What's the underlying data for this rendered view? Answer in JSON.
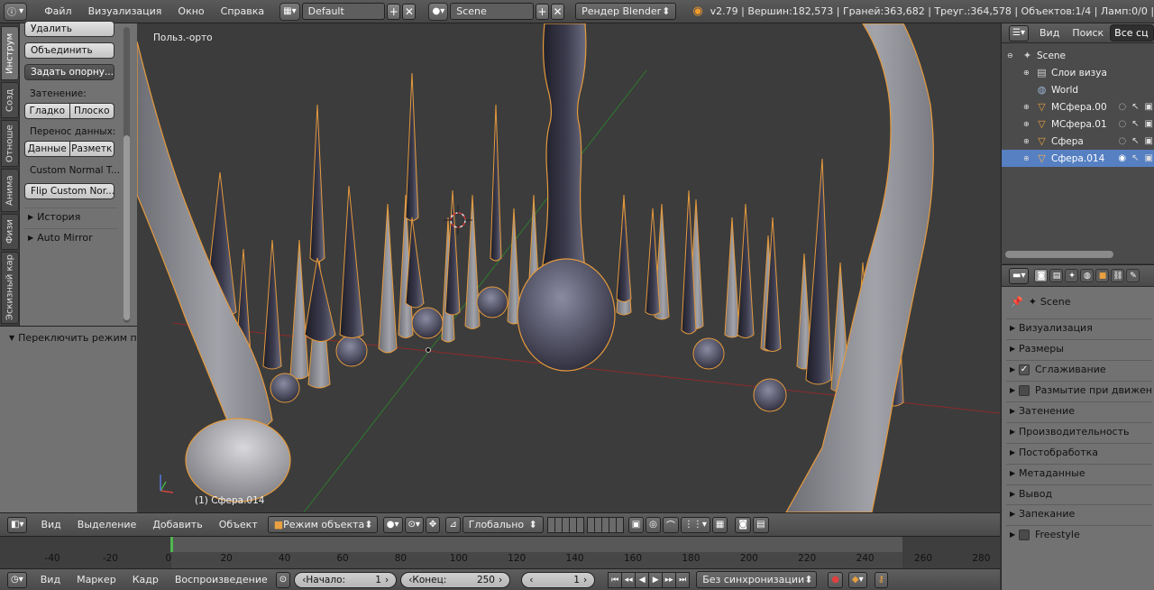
{
  "topbar": {
    "menus": [
      "Файл",
      "Визуализация",
      "Окно",
      "Справка"
    ],
    "layout": "Default",
    "scene": "Scene",
    "engine": "Рендер Blender",
    "stats": "v2.79 | Вершин:182,573 | Граней:363,682 | Треуг.:364,578 | Объектов:1/4 | Ламп:0/0 |"
  },
  "tool_tabs": [
    "Инструм",
    "Созд",
    "Отноше",
    "Анима",
    "Физи",
    "Эскизный кар"
  ],
  "shelf": {
    "delete": "Удалить",
    "join": "Объединить",
    "set_origin": "Задать опорну...",
    "shading_label": "Затенение:",
    "smooth": "Гладко",
    "flat": "Плоско",
    "data_transfer_label": "Перенос данных:",
    "data": "Данные",
    "layout": "Разметк",
    "custom_normal": "Custom Normal T...",
    "flip_custom": "Flip Custom Nor...",
    "history": "История",
    "auto_mirror": "Auto Mirror"
  },
  "last_operator": "Переключить режим п",
  "viewport": {
    "view_label": "Польз.-орто",
    "object_label": "(1) Сфера.014"
  },
  "view3d_header": {
    "menus": [
      "Вид",
      "Выделение",
      "Добавить",
      "Объект"
    ],
    "mode": "Режим объекта",
    "orientation": "Глобально"
  },
  "timeline": {
    "ticks": [
      "-40",
      "-20",
      "0",
      "20",
      "40",
      "60",
      "80",
      "100",
      "120",
      "140",
      "160",
      "180",
      "200",
      "220",
      "240",
      "260",
      "280"
    ],
    "current_frame_value": 1
  },
  "timeline_header": {
    "menus": [
      "Вид",
      "Маркер",
      "Кадр",
      "Воспроизведение"
    ],
    "start_label": "Начало:",
    "start_value": "1",
    "end_label": "Конец:",
    "end_value": "250",
    "current": "1",
    "sync": "Без синхронизации"
  },
  "outliner": {
    "view": "Вид",
    "search": "Поиск",
    "filter": "Все сц",
    "rows": [
      "Scene",
      "Слои визуа",
      "World",
      "МСфера.00",
      "МСфера.01",
      "Сфера",
      "Сфера.014"
    ]
  },
  "properties": {
    "context": "Scene",
    "sections": [
      "Визуализация",
      "Размеры",
      "Сглаживание",
      "Размытие при движен",
      "Затенение",
      "Производительность",
      "Постобработка",
      "Метаданные",
      "Вывод",
      "Запекание",
      "Freestyle"
    ]
  },
  "colors": {
    "accent": "#5680c2",
    "selection_outline": "#e59a3c",
    "current_frame": "#4fb74f"
  }
}
